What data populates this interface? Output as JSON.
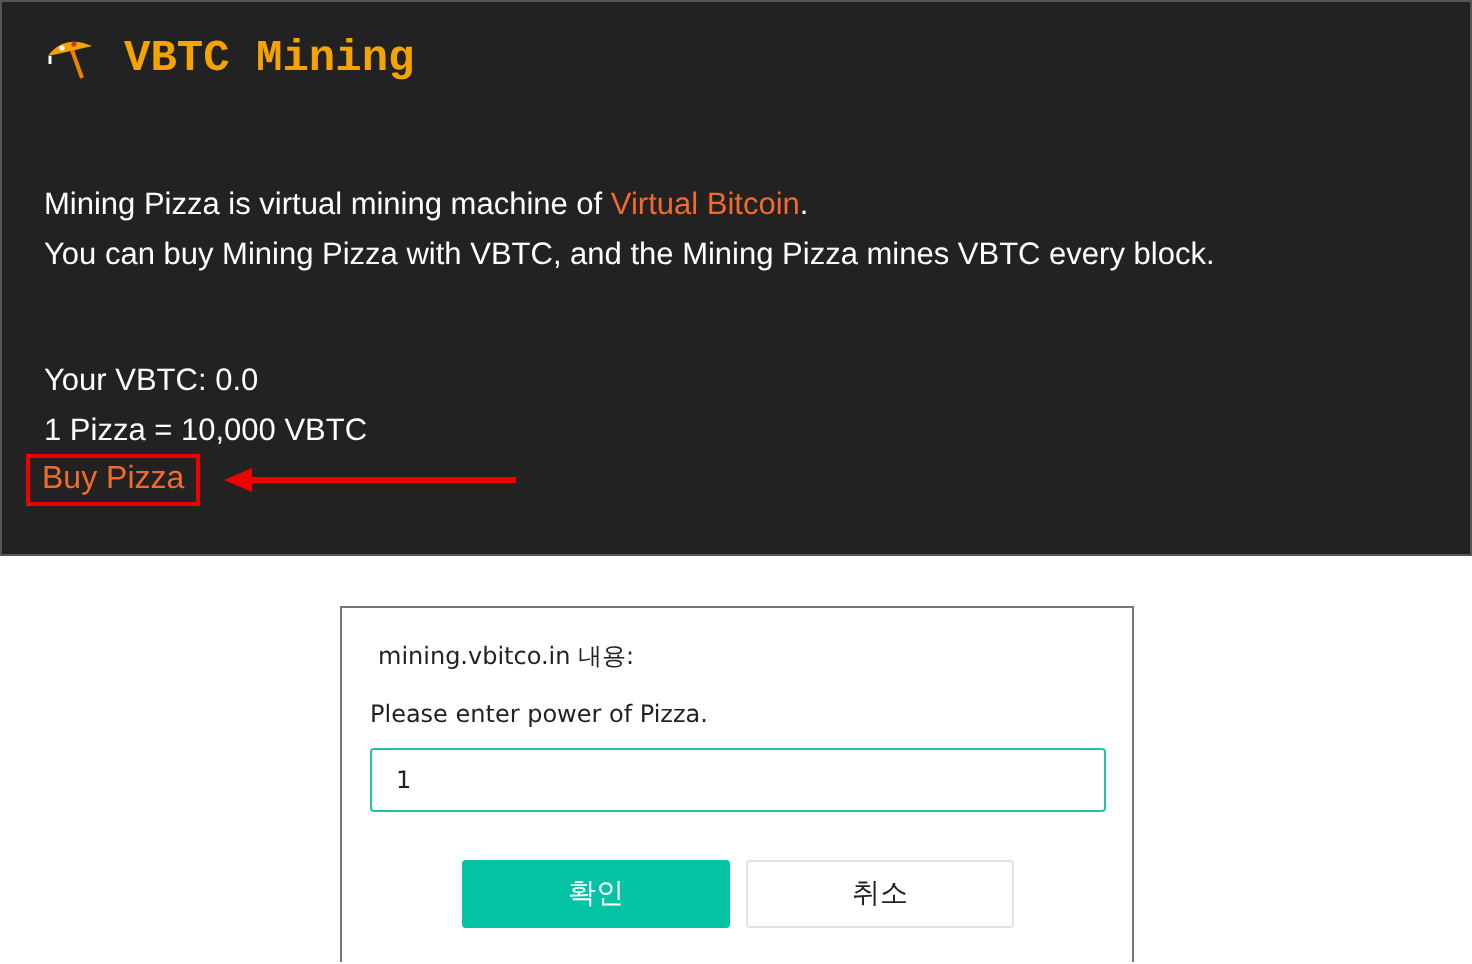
{
  "header": {
    "title": "VBTC Mining"
  },
  "intro": {
    "before": "Mining Pizza is virtual mining machine of ",
    "link": "Virtual Bitcoin",
    "after": "."
  },
  "description": "You can buy Mining Pizza with VBTC, and the Mining Pizza mines VBTC every block.",
  "balance": "Your VBTC: 0.0",
  "price": "1 Pizza = 10,000 VBTC",
  "buy_link": {
    "label": "Buy Pizza",
    "highlighted": true
  },
  "dialog": {
    "origin": "mining.vbitco.in 내용:",
    "message": "Please enter power of Pizza.",
    "value": "1",
    "buttons": [
      {
        "label": "확인",
        "kind": "primary"
      },
      {
        "label": "취소",
        "kind": "secondary"
      }
    ]
  }
}
